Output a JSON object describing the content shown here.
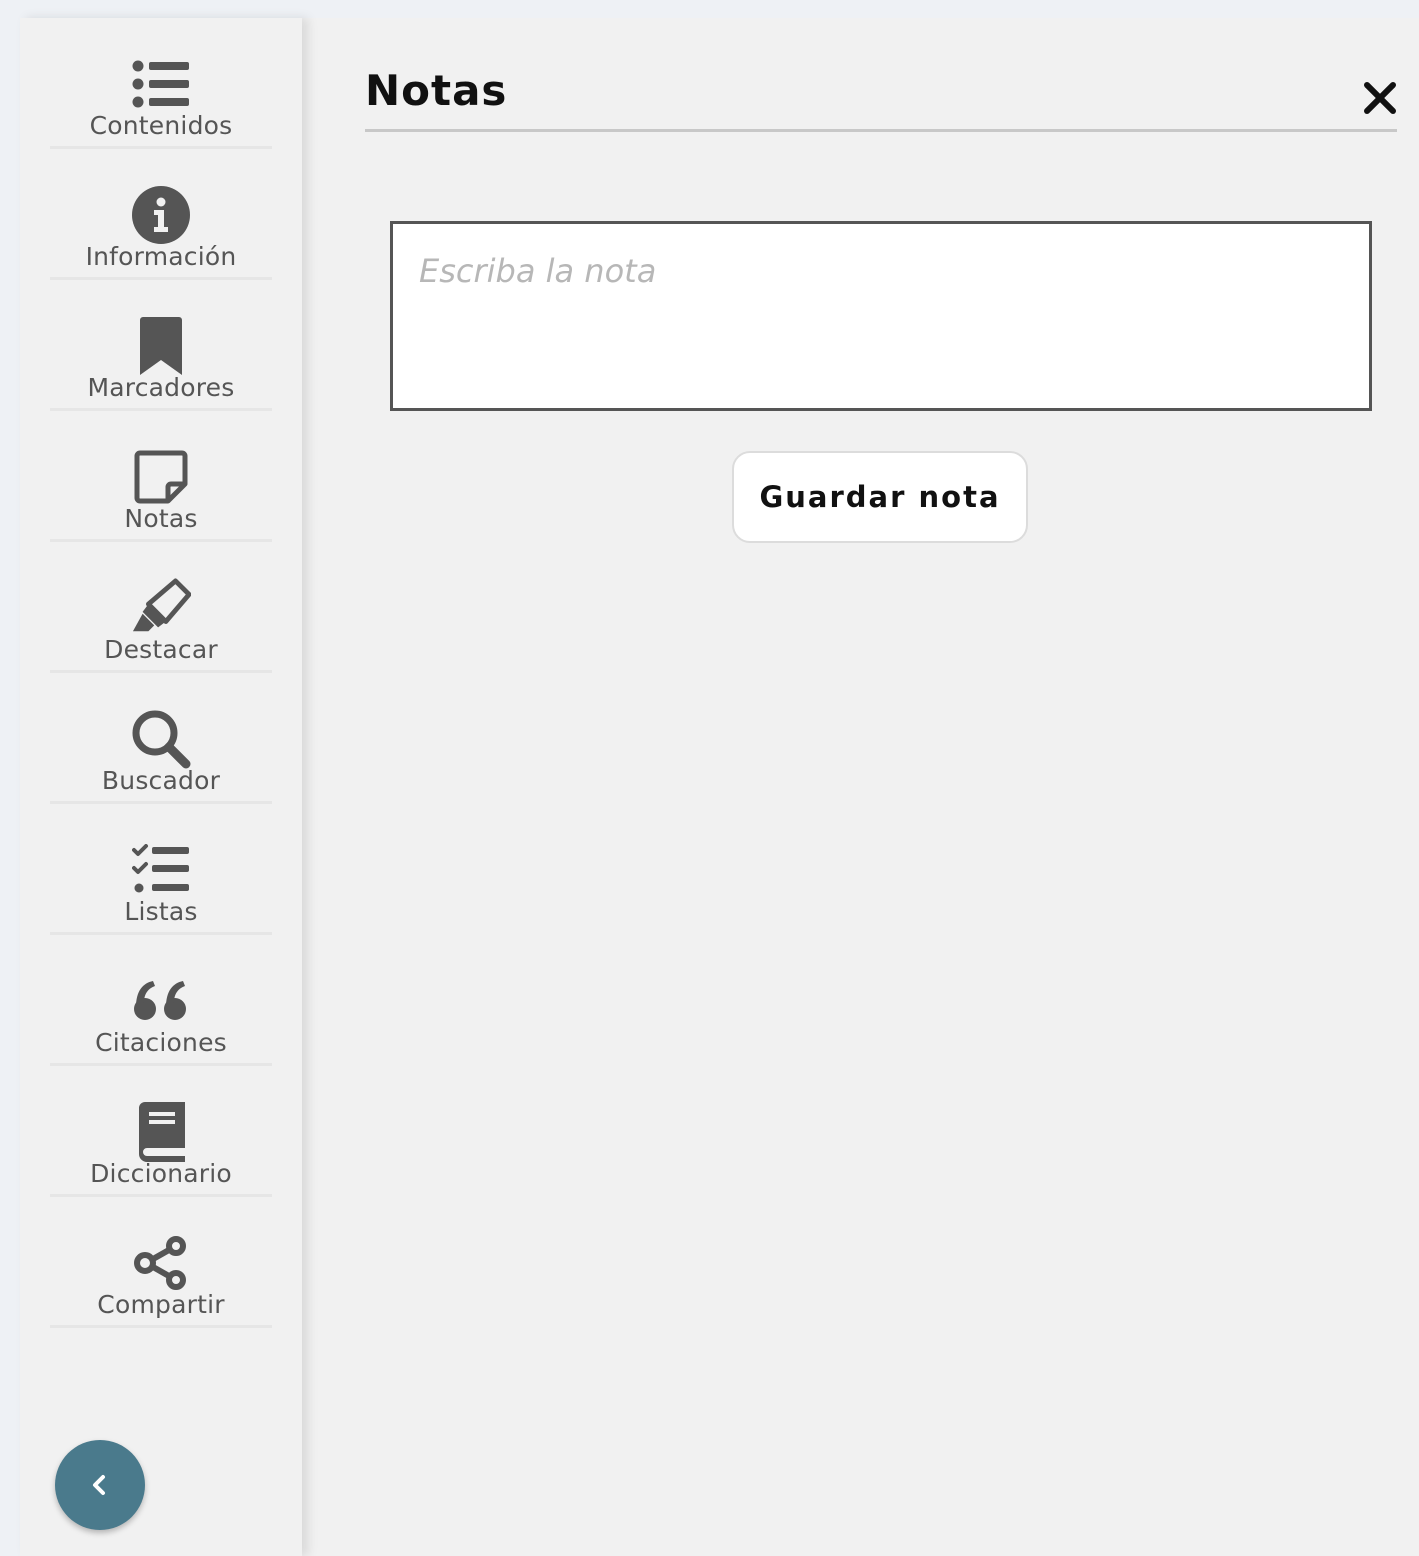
{
  "sidebar": {
    "items": [
      {
        "label": "Contenidos",
        "icon": "list-icon"
      },
      {
        "label": "Información",
        "icon": "info-icon"
      },
      {
        "label": "Marcadores",
        "icon": "bookmark-icon"
      },
      {
        "label": "Notas",
        "icon": "sticky-note-icon"
      },
      {
        "label": "Destacar",
        "icon": "highlighter-icon"
      },
      {
        "label": "Buscador",
        "icon": "search-icon"
      },
      {
        "label": "Listas",
        "icon": "checklist-icon"
      },
      {
        "label": "Citaciones",
        "icon": "quote-icon"
      },
      {
        "label": "Diccionario",
        "icon": "book-icon"
      },
      {
        "label": "Compartir",
        "icon": "share-icon"
      }
    ],
    "collapse_icon": "chevron-left-icon",
    "collapse_color": "#4a7a8c",
    "icon_color": "#555555"
  },
  "panel": {
    "title": "Notas",
    "close_icon": "close-icon",
    "note_placeholder": "Escriba la nota",
    "note_value": "",
    "save_label": "Guardar nota"
  }
}
